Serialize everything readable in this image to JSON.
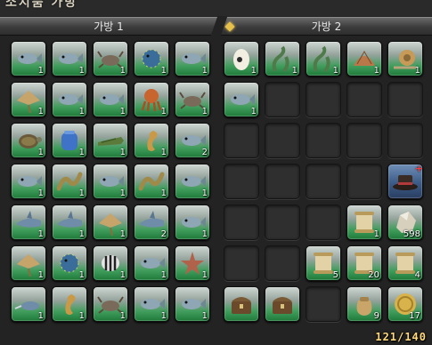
{
  "window": {
    "title": "소지품 가방"
  },
  "tabs": [
    {
      "label": "가방 1",
      "active": false
    },
    {
      "label": "가방 2",
      "active": true
    }
  ],
  "bag1": {
    "rows": [
      [
        {
          "icon": "fish-icon",
          "count": "1"
        },
        {
          "icon": "fish-icon",
          "count": "1"
        },
        {
          "icon": "crab-icon",
          "count": "1"
        },
        {
          "icon": "pufferfish-icon",
          "count": "1"
        },
        {
          "icon": "fish-icon",
          "count": "1"
        }
      ],
      [
        {
          "icon": "stingray-icon",
          "count": "1"
        },
        {
          "icon": "fish-icon",
          "count": "1"
        },
        {
          "icon": "fish-icon",
          "count": "1"
        },
        {
          "icon": "octopus-icon",
          "count": "1"
        },
        {
          "icon": "crab-icon",
          "count": "1"
        }
      ],
      [
        {
          "icon": "turtle-icon",
          "count": "1"
        },
        {
          "icon": "jar-icon",
          "count": "1"
        },
        {
          "icon": "crocodile-icon",
          "count": "1"
        },
        {
          "icon": "seahorse-icon",
          "count": "1"
        },
        {
          "icon": "fish-icon",
          "count": "2"
        }
      ],
      [
        {
          "icon": "fish-icon",
          "count": "1"
        },
        {
          "icon": "eel-icon",
          "count": "1"
        },
        {
          "icon": "fish-icon",
          "count": "1"
        },
        {
          "icon": "eel-icon",
          "count": "1"
        },
        {
          "icon": "fish-icon",
          "count": "1"
        }
      ],
      [
        {
          "icon": "shark-icon",
          "count": "1"
        },
        {
          "icon": "shark-icon",
          "count": "1"
        },
        {
          "icon": "stingray-icon",
          "count": "1"
        },
        {
          "icon": "shark-icon",
          "count": "2"
        },
        {
          "icon": "fish-icon",
          "count": "1"
        }
      ],
      [
        {
          "icon": "stingray-icon",
          "count": "1"
        },
        {
          "icon": "pufferfish-icon",
          "count": "1"
        },
        {
          "icon": "striped-fish-icon",
          "count": "1"
        },
        {
          "icon": "fish-icon",
          "count": "1"
        },
        {
          "icon": "starfish-icon",
          "count": "1"
        }
      ],
      [
        {
          "icon": "swordfish-icon",
          "count": "1"
        },
        {
          "icon": "seahorse-icon",
          "count": "1"
        },
        {
          "icon": "crab-icon",
          "count": "1"
        },
        {
          "icon": "fish-icon",
          "count": "1"
        },
        {
          "icon": "fish-icon",
          "count": "1"
        }
      ]
    ]
  },
  "bag2": {
    "rows": [
      [
        {
          "icon": "egg-icon",
          "count": "1"
        },
        {
          "icon": "seaweed-icon",
          "count": "1"
        },
        {
          "icon": "seaweed-icon",
          "count": "1"
        },
        {
          "icon": "shell-icon",
          "count": "1"
        },
        {
          "icon": "snail-icon",
          "count": "1"
        }
      ],
      [
        {
          "icon": "fish-icon",
          "count": "1"
        },
        null,
        null,
        null,
        null
      ],
      [
        null,
        null,
        null,
        null,
        null
      ],
      [
        null,
        null,
        null,
        null,
        {
          "icon": "hat-icon",
          "count": "",
          "variant": "blue",
          "badge": "+"
        }
      ],
      [
        null,
        null,
        null,
        {
          "icon": "scroll-icon",
          "count": "1"
        },
        {
          "icon": "ore-icon",
          "count": "598"
        }
      ],
      [
        null,
        null,
        {
          "icon": "scroll-icon",
          "count": "5"
        },
        {
          "icon": "scroll-icon",
          "count": "20"
        },
        {
          "icon": "scroll-icon",
          "count": "4"
        }
      ],
      [
        {
          "icon": "chest-icon",
          "count": ""
        },
        {
          "icon": "chest-icon",
          "count": ""
        },
        null,
        {
          "icon": "pouch-icon",
          "count": "9"
        },
        {
          "icon": "coin-icon",
          "count": "17"
        }
      ]
    ]
  },
  "capacity": "121/140",
  "colors": {
    "slot_green": "#2f8d4a",
    "capacity": "#ffd97a",
    "tab_marker": "#e6c04a"
  }
}
